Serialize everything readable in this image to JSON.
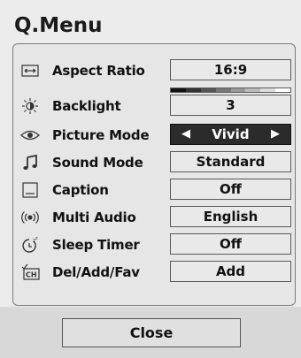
{
  "window": {
    "title": "Q.Menu"
  },
  "items": [
    {
      "icon": "aspect-ratio-icon",
      "label": "Aspect Ratio",
      "value": "16:9",
      "selected": false
    },
    {
      "icon": "backlight-icon",
      "label": "Backlight",
      "value": "3",
      "selected": false,
      "level_fraction": 0.3
    },
    {
      "icon": "eye-icon",
      "label": "Picture Mode",
      "value": "Vivid",
      "selected": true
    },
    {
      "icon": "music-note-icon",
      "label": "Sound Mode",
      "value": "Standard",
      "selected": false
    },
    {
      "icon": "caption-icon",
      "label": "Caption",
      "value": "Off",
      "selected": false
    },
    {
      "icon": "audio-waves-icon",
      "label": "Multi Audio",
      "value": "English",
      "selected": false
    },
    {
      "icon": "sleep-timer-icon",
      "label": "Sleep Timer",
      "value": "Off",
      "selected": false
    },
    {
      "icon": "channel-icon",
      "label": "Del/Add/Fav",
      "value": "Add",
      "selected": false
    }
  ],
  "arrows": {
    "left": "◀",
    "right": "▶"
  },
  "footer": {
    "close_label": "Close"
  },
  "colors": {
    "panel": "#ececec",
    "selected_bg": "#2b2b2b",
    "selected_text": "#ffffff",
    "border": "#5a5a5a"
  }
}
